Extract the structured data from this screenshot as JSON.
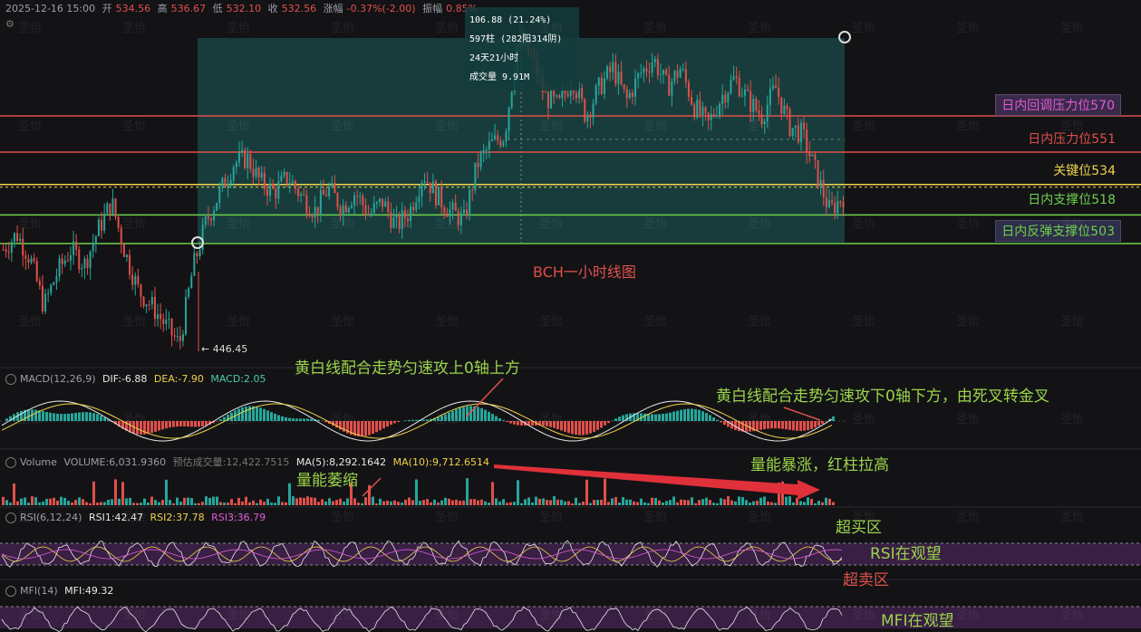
{
  "header": {
    "datetime": "2025-12-16 15:00",
    "open_label": "开",
    "open": "534.56",
    "high_label": "高",
    "high": "536.67",
    "low_label": "低",
    "low": "532.10",
    "close_label": "收",
    "close": "532.56",
    "change_label": "涨幅",
    "change": "-0.37%(-2.00)",
    "amp_label": "振幅",
    "amp": "0.85%"
  },
  "tooltip": {
    "line1": "106.88 (21.24%)",
    "line2": "597柱 (282阳314阴)",
    "line3": "24天21小时",
    "line4": "成交量 9.91M"
  },
  "levels": [
    {
      "label": "日内回调压力位570",
      "value": 570,
      "color": "#e0504a",
      "boxed": true
    },
    {
      "label": "日内压力位551",
      "value": 551,
      "color": "#e0504a",
      "boxed": false
    },
    {
      "label": "关键位534",
      "value": 534,
      "color": "#f0d24a",
      "boxed": false
    },
    {
      "label": "日内支撑位518",
      "value": 518,
      "color": "#6ed04a",
      "boxed": false
    },
    {
      "label": "日内反弹支撑位503",
      "value": 503,
      "color": "#6ed04a",
      "boxed": true
    }
  ],
  "low_marker": "← 446.45",
  "chart_title": "BCH一小时线图",
  "macd": {
    "name": "MACD(12,26,9)",
    "dif": "DIF:-6.88",
    "dea": "DEA:-7.90",
    "macd": "MACD:2.05"
  },
  "volume": {
    "name": "Volume",
    "volume": "VOLUME:6,031.9360",
    "est": "预估成交量:12,422.7515",
    "ma5": "MA(5):8,292.1642",
    "ma10": "MA(10):9,712.6514"
  },
  "rsi": {
    "name": "RSI(6,12,24)",
    "rsi1": "RSI1:42.47",
    "rsi2": "RSI2:37.78",
    "rsi3": "RSI3:36.79"
  },
  "mfi": {
    "name": "MFI(14)",
    "mfi": "MFI:49.32"
  },
  "annotations": {
    "macd_up": "黄白线配合走势匀速攻上0轴上方",
    "macd_down": "黄白线配合走势匀速攻下0轴下方，由死叉转金叉",
    "vol_shrink": "量能萎缩",
    "vol_surge": "量能暴涨，红柱拉高",
    "overbought": "超买区",
    "rsi_watch": "RSI在观望",
    "oversold": "超卖区",
    "mfi_watch": "MFI在观望"
  },
  "watermark": "圣怡",
  "colors": {
    "up": "#26a69a",
    "down": "#e0504a",
    "box": "#1f6f6a",
    "white_line": "#e8e8e8",
    "yellow_line": "#f0d24a",
    "band": "#5a2a6a"
  },
  "chart_data": {
    "type": "candlestick",
    "title": "BCH一小时线图",
    "horizontal_levels": [
      570,
      551,
      534,
      518,
      503
    ],
    "range_box": {
      "change": 106.88,
      "change_pct": 21.24,
      "bars": 597,
      "up_bars": 282,
      "down_bars": 314,
      "duration": "24天21小时",
      "volume": "9.91M"
    },
    "annotated_low": 446.45,
    "last_bar": {
      "open": 534.56,
      "high": 536.67,
      "low": 532.1,
      "close": 532.56
    },
    "macd": {
      "dif": -6.88,
      "dea": -7.9,
      "macd": 2.05
    },
    "volume": {
      "volume": 6031.936,
      "ma5": 8292.1642,
      "ma10": 9712.6514
    },
    "rsi": {
      "rsi1": 42.47,
      "rsi2": 37.78,
      "rsi3": 36.79
    },
    "mfi": 49.32,
    "price_path": [
      500,
      508,
      495,
      470,
      488,
      500,
      492,
      510,
      525,
      498,
      478,
      470,
      460,
      450,
      490,
      515,
      530,
      545,
      548,
      535,
      530,
      538,
      528,
      520,
      532,
      522,
      530,
      518,
      525,
      512,
      520,
      540,
      528,
      520,
      515,
      545,
      555,
      560,
      610,
      600,
      580,
      575,
      590,
      570,
      585,
      595,
      578,
      592,
      600,
      585,
      595,
      575,
      565,
      580,
      590,
      578,
      570,
      585,
      565,
      560,
      540,
      520,
      528
    ]
  }
}
